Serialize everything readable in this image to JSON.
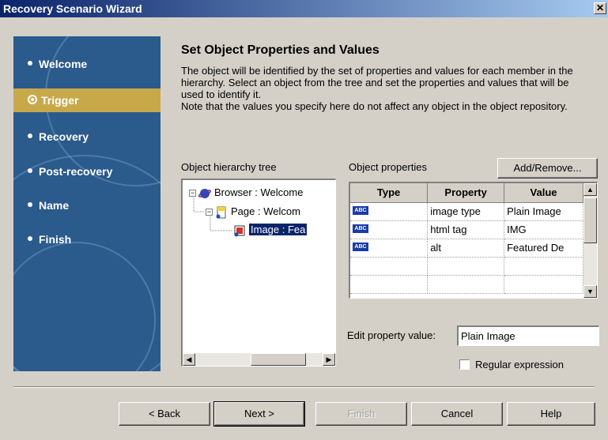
{
  "window": {
    "title": "Recovery Scenario Wizard",
    "close_glyph": "✕"
  },
  "sidebar": {
    "items": [
      {
        "label": "Welcome",
        "active": false
      },
      {
        "label": "Trigger",
        "active": true
      },
      {
        "label": "Recovery",
        "active": false
      },
      {
        "label": "Post-recovery",
        "active": false
      },
      {
        "label": "Name",
        "active": false
      },
      {
        "label": "Finish",
        "active": false
      }
    ]
  },
  "main": {
    "heading": "Set Object Properties and Values",
    "description_1": "The object will be identified by the set of properties and values for each member in the hierarchy. Select an object from the tree and set the properties and values that will be used to identify it.",
    "description_2": "Note that the values you specify here do not affect any object in the object repository."
  },
  "tree": {
    "label": "Object hierarchy tree",
    "nodes": [
      {
        "text": "Browser : Welcome",
        "icon": "browser-icon"
      },
      {
        "text": "Page : Welcom",
        "icon": "page-icon"
      },
      {
        "text": "Image : Fea",
        "icon": "image-icon",
        "selected": true
      }
    ]
  },
  "properties": {
    "label": "Object properties",
    "add_remove_label": "Add/Remove...",
    "columns": [
      "Type",
      "Property",
      "Value"
    ],
    "rows": [
      {
        "type": "ABC",
        "property": "image type",
        "value": "Plain Image"
      },
      {
        "type": "ABC",
        "property": "html tag",
        "value": "IMG"
      },
      {
        "type": "ABC",
        "property": "alt",
        "value": "Featured De"
      }
    ]
  },
  "edit": {
    "label": "Edit property value:",
    "value": "Plain Image",
    "regex_label": "Regular expression",
    "regex_checked": false
  },
  "buttons": {
    "back": "< Back",
    "next": "Next >",
    "finish": "Finish",
    "cancel": "Cancel",
    "help": "Help"
  },
  "colors": {
    "sidebar_bg": "#2b5a8c",
    "sidebar_active": "#c8a94a",
    "selection": "#0a246a",
    "dialog_bg": "#d4d0c8"
  }
}
